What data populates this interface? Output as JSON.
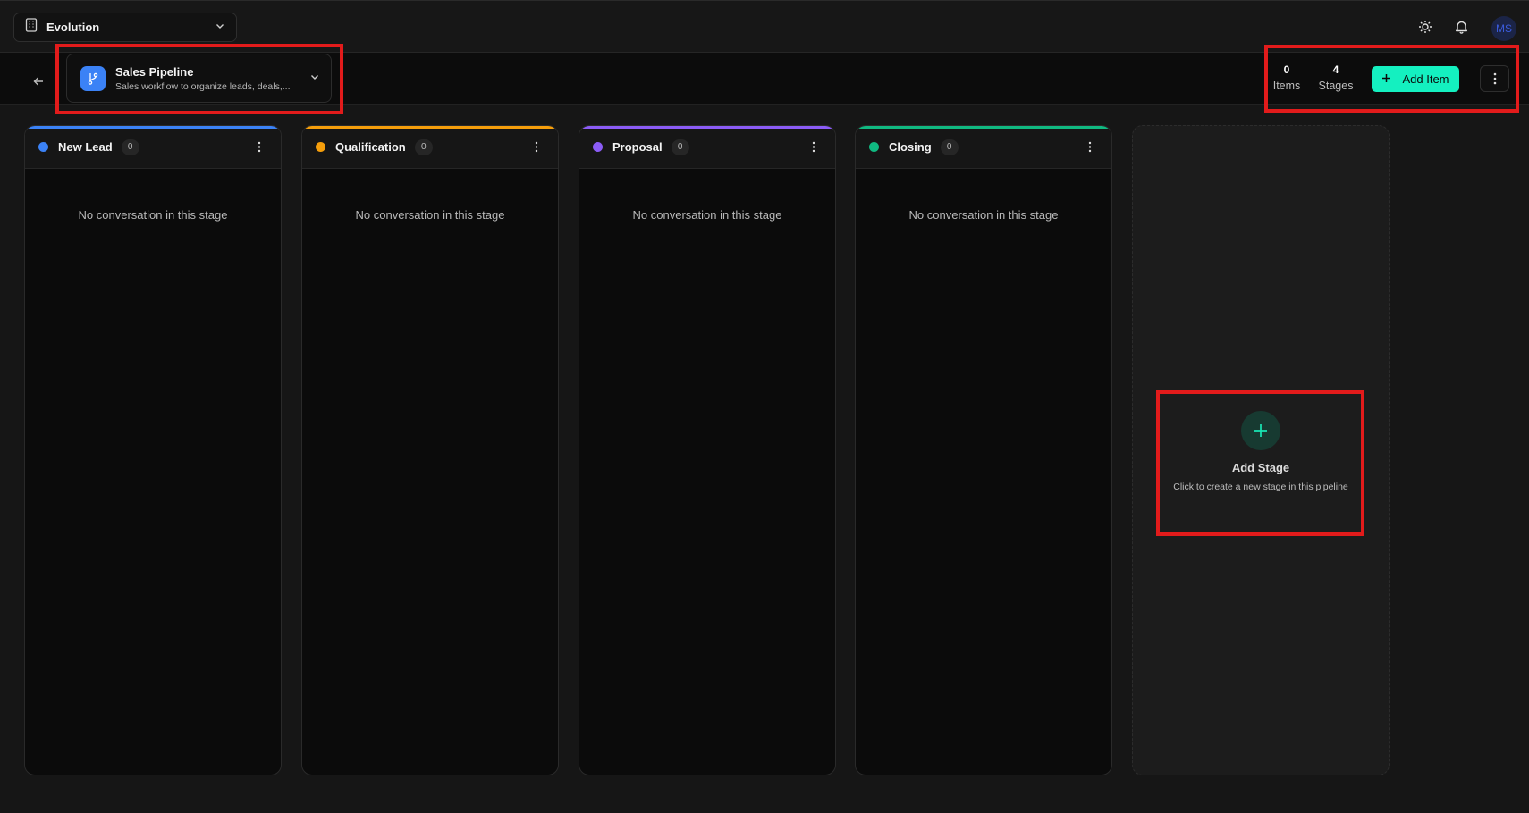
{
  "topbar": {
    "org_name": "Evolution",
    "avatar_initials": "MS"
  },
  "pipeline": {
    "title": "Sales Pipeline",
    "description": "Sales workflow to organize leads, deals,..."
  },
  "stats": {
    "items_count": "0",
    "items_label": "Items",
    "stages_count": "4",
    "stages_label": "Stages"
  },
  "actions": {
    "add_item_label": "Add Item"
  },
  "stages": [
    {
      "name": "New Lead",
      "count": "0",
      "color": "#3b82f6",
      "empty_text": "No conversation in this stage"
    },
    {
      "name": "Qualification",
      "count": "0",
      "color": "#f59e0b",
      "empty_text": "No conversation in this stage"
    },
    {
      "name": "Proposal",
      "count": "0",
      "color": "#8b5cf6",
      "empty_text": "No conversation in this stage"
    },
    {
      "name": "Closing",
      "count": "0",
      "color": "#10b981",
      "empty_text": "No conversation in this stage"
    }
  ],
  "add_stage": {
    "title": "Add Stage",
    "subtitle": "Click to create a new stage in this pipeline"
  },
  "colors": {
    "accent": "#14f0c0",
    "annotation": "#e21b1b"
  }
}
